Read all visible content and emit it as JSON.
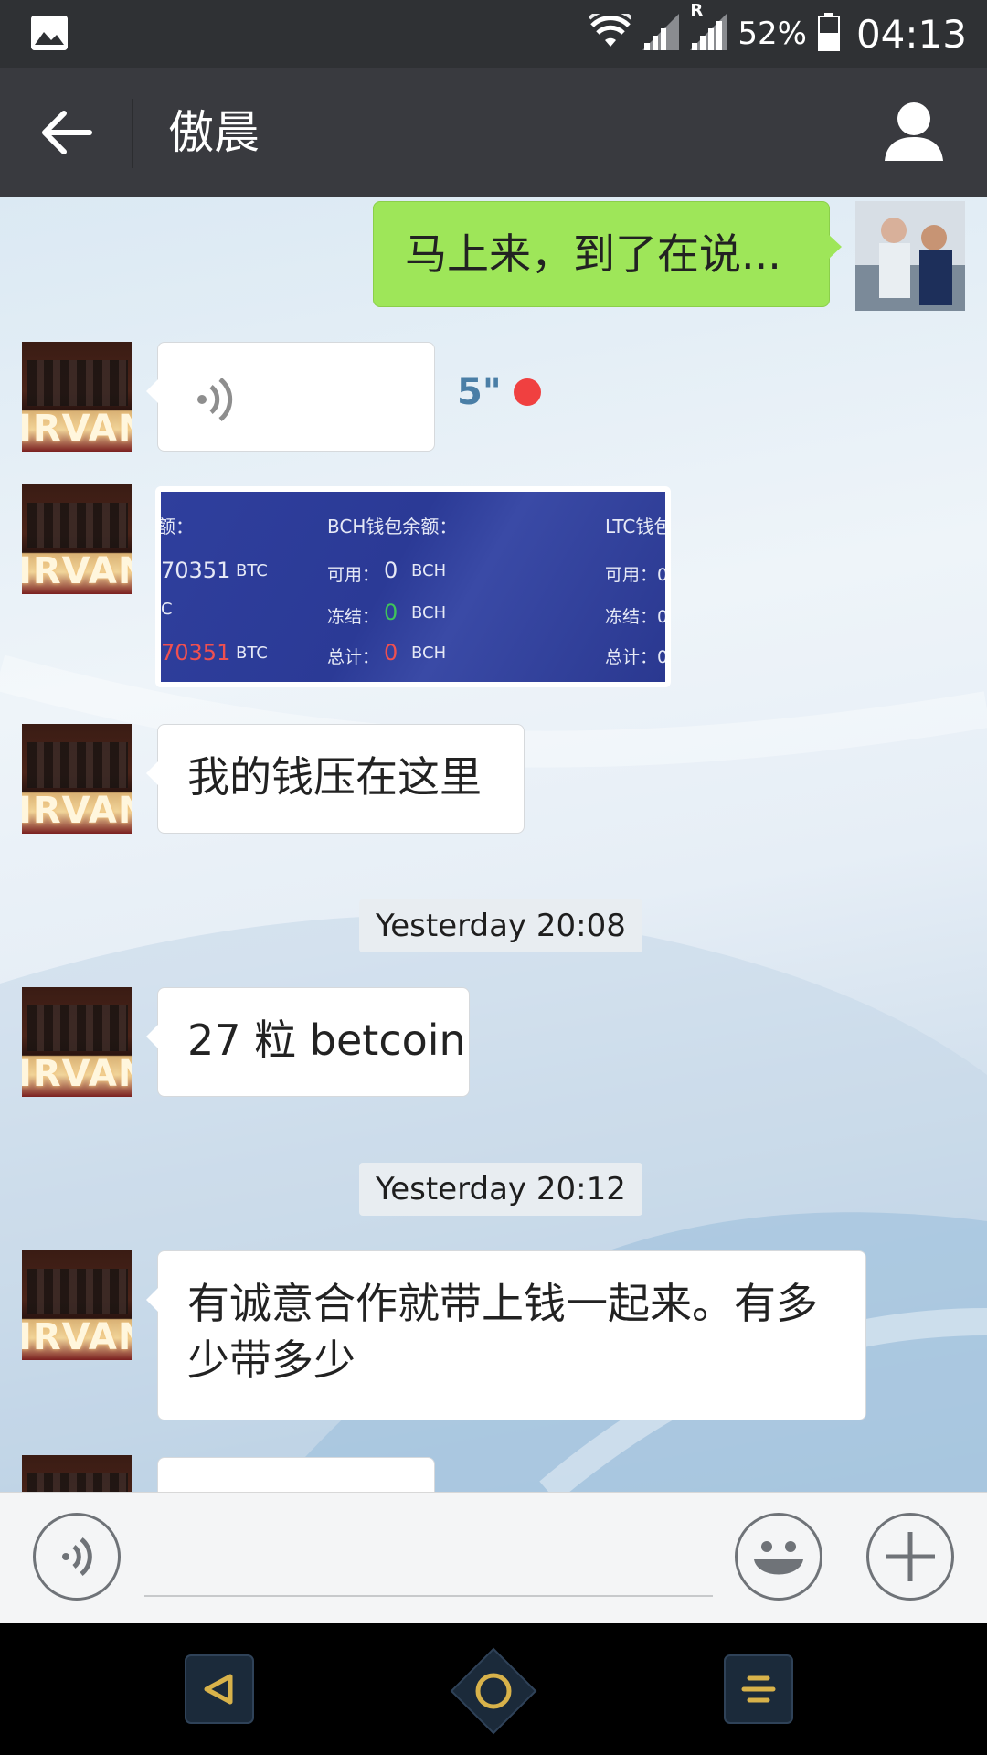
{
  "status_bar": {
    "icons": [
      "gallery-icon",
      "wifi-icon",
      "signal-icon",
      "roaming-signal-icon",
      "battery-icon"
    ],
    "roaming_indicator": "R",
    "battery": "52%",
    "time": "04:13"
  },
  "header": {
    "title": "傲晨",
    "back_icon": "arrow-left-icon",
    "profile_icon": "person-icon"
  },
  "messages": [
    {
      "sender": "self",
      "type": "text",
      "text": "马上来，到了在说..."
    },
    {
      "sender": "contact",
      "type": "voice",
      "duration": "5\"",
      "unread": true
    },
    {
      "sender": "contact",
      "type": "image",
      "image_text": {
        "col1_header": "额：",
        "col1_available": "70351",
        "col1_available_unit": "BTC",
        "col1_frozen_unit": "C",
        "col1_total": "70351",
        "col1_total_unit": "BTC",
        "col2_header": "BCH钱包余额：",
        "col2_available_label": "可用：",
        "col2_available_value": "0",
        "col2_available_unit": "BCH",
        "col2_frozen_label": "冻结：",
        "col2_frozen_value": "0",
        "col2_frozen_unit": "BCH",
        "col2_total_label": "总计：",
        "col2_total_value": "0",
        "col2_total_unit": "BCH",
        "col3_header": "LTC钱包",
        "col3_available_label": "可用：0",
        "col3_frozen_label": "冻结：0",
        "col3_total_label": "总计：0"
      }
    },
    {
      "sender": "contact",
      "type": "text",
      "text": "我的钱压在这里"
    },
    {
      "type": "timestamp",
      "text": "Yesterday 20:08"
    },
    {
      "sender": "contact",
      "type": "text",
      "text": "27 粒 betcoin"
    },
    {
      "type": "timestamp",
      "text": "Yesterday 20:12"
    },
    {
      "sender": "contact",
      "type": "text",
      "text": "有诚意合作就带上钱一起来。有多少带多少"
    }
  ],
  "contact_avatar_text": "IRVANA",
  "input_bar": {
    "voice_icon": "voice-icon",
    "emoji_icon": "emoji-icon",
    "plus_icon": "plus-icon",
    "value": ""
  },
  "nav_bar": {
    "icons": [
      "back-triangle-icon",
      "home-circle-icon",
      "menu-lines-icon"
    ]
  },
  "colors": {
    "title_bar": "#393a3f",
    "status_bar": "#2f3134",
    "self_bubble": "#9ee659",
    "unread_dot": "#f04040",
    "voice_duration": "#4a7ea6",
    "nav_accent": "#d8b24a"
  }
}
